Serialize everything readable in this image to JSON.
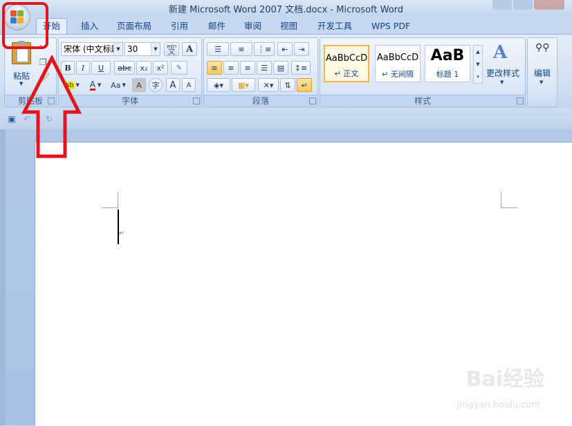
{
  "window": {
    "title": "新建 Microsoft Word 2007 文档.docx - Microsoft Word"
  },
  "tabs": [
    {
      "label": "开始",
      "active": true
    },
    {
      "label": "插入"
    },
    {
      "label": "页面布局"
    },
    {
      "label": "引用"
    },
    {
      "label": "邮件"
    },
    {
      "label": "审阅"
    },
    {
      "label": "视图"
    },
    {
      "label": "开发工具"
    },
    {
      "label": "WPS PDF"
    }
  ],
  "clipboard": {
    "group_label": "剪贴板",
    "paste_label": "粘贴"
  },
  "font": {
    "group_label": "字体",
    "font_name": "宋体 (中文标题",
    "font_size": "30",
    "phonetic_glyph": "wén",
    "phonetic_char": "文",
    "bold": "B",
    "italic": "I",
    "underline": "U",
    "strike": "abc",
    "subscript": "x₂",
    "superscript": "x²",
    "highlight": "ab",
    "font_color": "A",
    "change_case": "Aa",
    "char_border": "A",
    "enclose": "字",
    "grow": "A",
    "shrink": "A"
  },
  "paragraph": {
    "group_label": "段落"
  },
  "styles": {
    "group_label": "样式",
    "items": [
      {
        "sample": "AaBbCcD",
        "name": "↵ 正文",
        "selected": true
      },
      {
        "sample": "AaBbCcD",
        "name": "↵ 无间隔"
      },
      {
        "sample": "AaB",
        "name": "标题 1"
      }
    ],
    "change_styles_label": "更改样式"
  },
  "editing": {
    "label": "编辑"
  },
  "watermark": {
    "brand": "Bai经验",
    "url": "jingyan.baidu.com"
  },
  "colors": {
    "highlight_red": "#e0151e",
    "accent": "#15428b"
  }
}
